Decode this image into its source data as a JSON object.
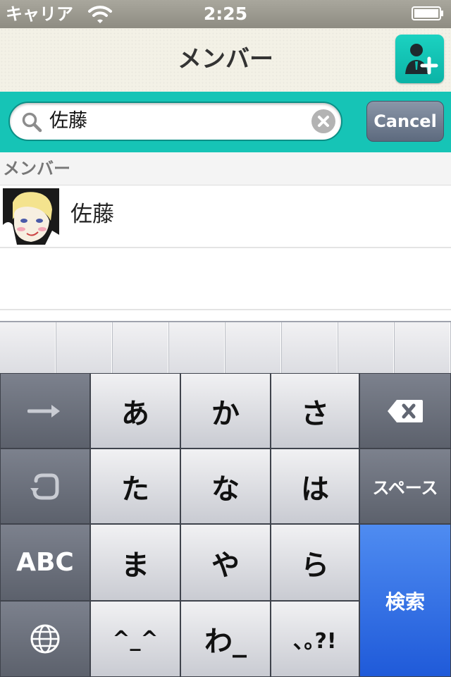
{
  "status_bar": {
    "carrier": "キャリア",
    "time": "2:25"
  },
  "nav": {
    "title": "メンバー"
  },
  "search": {
    "query": "佐藤",
    "cancel_label": "Cancel"
  },
  "section": {
    "header": "メンバー"
  },
  "members": [
    {
      "name": "佐藤"
    }
  ],
  "keyboard": {
    "rows": [
      [
        "→",
        "あ",
        "か",
        "さ",
        "⌫"
      ],
      [
        "↺",
        "た",
        "な",
        "は",
        "スペース"
      ],
      [
        "ABC",
        "ま",
        "や",
        "ら",
        "検索"
      ],
      [
        "🌐",
        "^_^",
        "わ_",
        "､｡?!"
      ]
    ],
    "kana": {
      "a": "あ",
      "ka": "か",
      "sa": "さ",
      "ta": "た",
      "na": "な",
      "ha": "は",
      "ma": "ま",
      "ya": "や",
      "ra": "ら",
      "emoticon": "^_^",
      "wa": "わ_",
      "punct": "､｡?!"
    },
    "abc_label": "ABC",
    "space_label": "スペース",
    "search_label": "検索"
  },
  "colors": {
    "accent": "#16c4b6",
    "keyboard_blue": "#2f6fe4"
  }
}
